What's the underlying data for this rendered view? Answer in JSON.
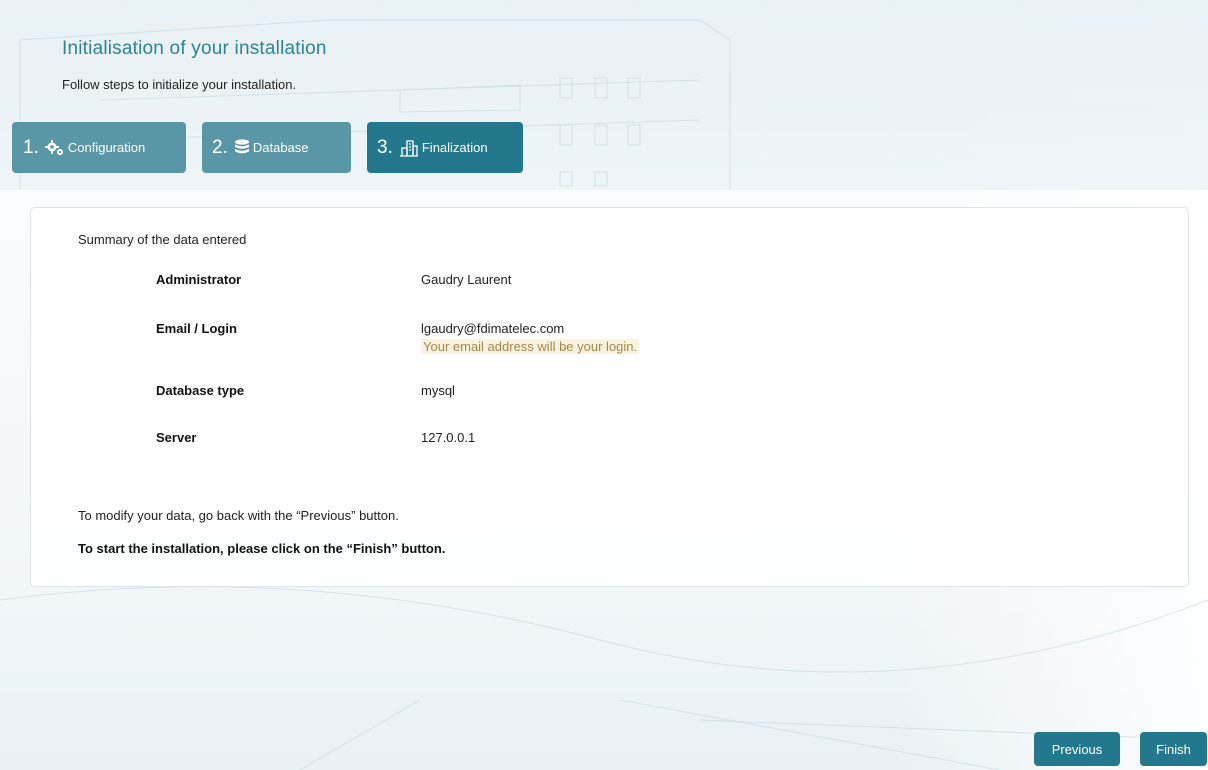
{
  "header": {
    "title": "Initialisation of your installation",
    "subtitle": "Follow steps to initialize your installation."
  },
  "steps": [
    {
      "number": "1.",
      "label": "Configuration",
      "icon": "gears-icon",
      "active": false
    },
    {
      "number": "2.",
      "label": "Database",
      "icon": "database-icon",
      "active": false
    },
    {
      "number": "3.",
      "label": "Finalization",
      "icon": "building-icon",
      "active": true
    }
  ],
  "summary": {
    "heading": "Summary of the data entered",
    "rows": [
      {
        "label": "Administrator",
        "value": "Gaudry Laurent"
      },
      {
        "label": "Email / Login",
        "value": "lgaudry@fdimatelec.com",
        "note": "Your email address will be your login."
      },
      {
        "label": "Database type",
        "value": "mysql"
      },
      {
        "label": "Server",
        "value": "127.0.0.1"
      }
    ],
    "hint_modify": "To modify your data, go back with the “Previous” button.",
    "hint_finish": "To start the installation, please click on the “Finish” button."
  },
  "buttons": {
    "previous": "Previous",
    "finish": "Finish"
  },
  "colors": {
    "accent": "#23788d",
    "step_inactive": "#5a97a6",
    "title": "#2d8296",
    "note_bg": "#fbf3df",
    "note_text": "#a2874a"
  }
}
